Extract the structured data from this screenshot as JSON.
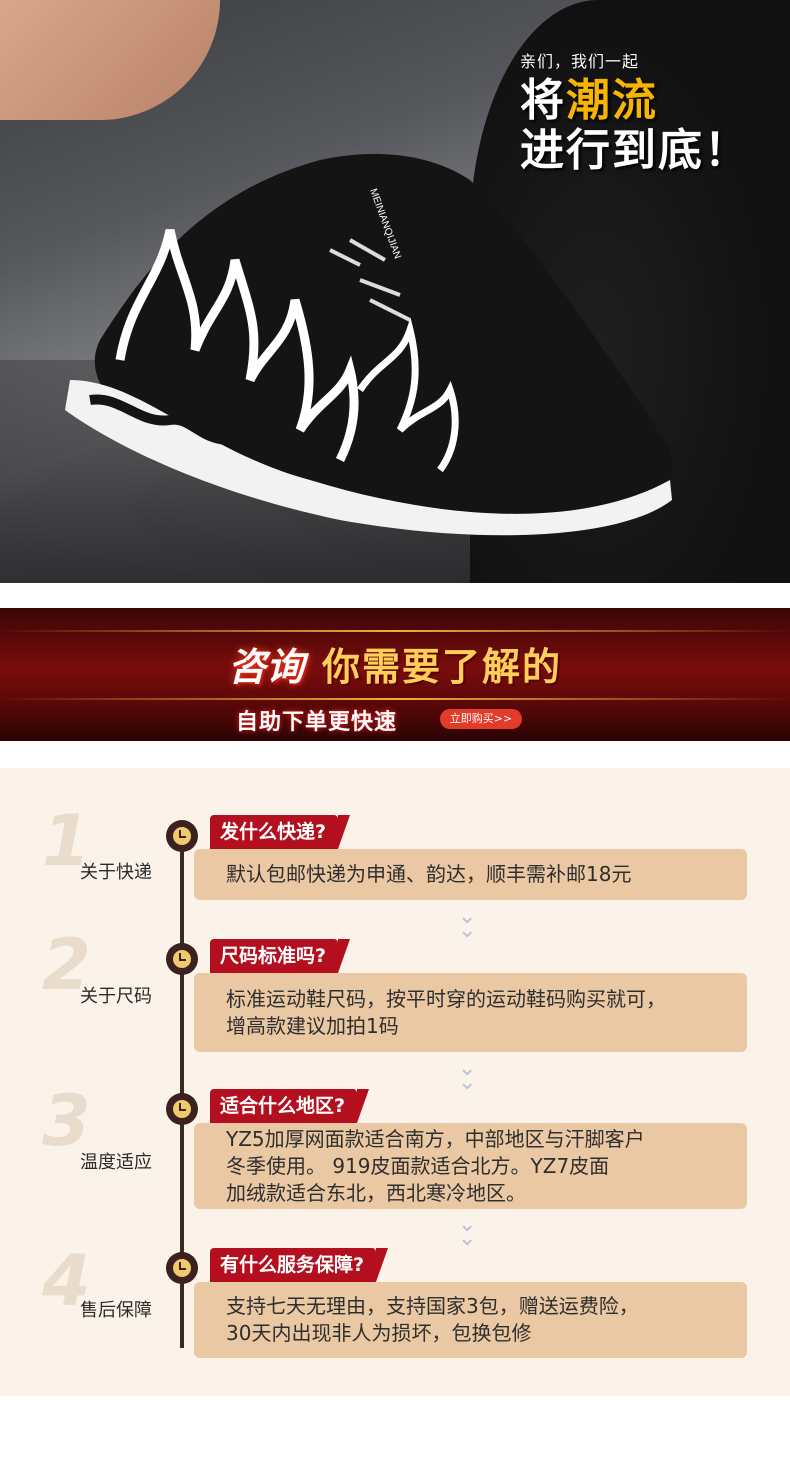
{
  "hero": {
    "slogan_small": "亲们，我们一起",
    "slogan_line1_a": "将",
    "slogan_line1_b": "潮流",
    "slogan_line2": "进行到底！",
    "tongue_text": "MEINIANQIJIAN"
  },
  "banner": {
    "title_a": "咨询",
    "title_b": "你需要了解的",
    "subtitle": "自助下单更快速",
    "buy_label": "立即购买>>"
  },
  "faq": [
    {
      "num": "1",
      "category": "关于快递",
      "question": "发什么快递?",
      "answer": "默认包邮快递为申通、韵达，顺丰需补邮18元"
    },
    {
      "num": "2",
      "category": "关于尺码",
      "question": "尺码标准吗?",
      "answer": "标准运动鞋尺码，按平时穿的运动鞋码购买就可，\n增高款建议加拍1码"
    },
    {
      "num": "3",
      "category": "温度适应",
      "question": "适合什么地区?",
      "answer": "YZ5加厚网面款适合南方，中部地区与汗脚客户\n冬季使用。 919皮面款适合北方。YZ7皮面\n加绒款适合东北，西北寒冷地区。"
    },
    {
      "num": "4",
      "category": "售后保障",
      "question": "有什么服务保障?",
      "answer": "支持七天无理由，支持国家3包，赠送运费险，\n30天内出现非人为损坏，包换包修"
    }
  ],
  "colors": {
    "accent_red": "#b40f1e",
    "answer_bg": "#eac8a3",
    "banner_red": "#7a0c0c"
  },
  "icons": [
    "clock-icon",
    "chevron-down-icon"
  ]
}
